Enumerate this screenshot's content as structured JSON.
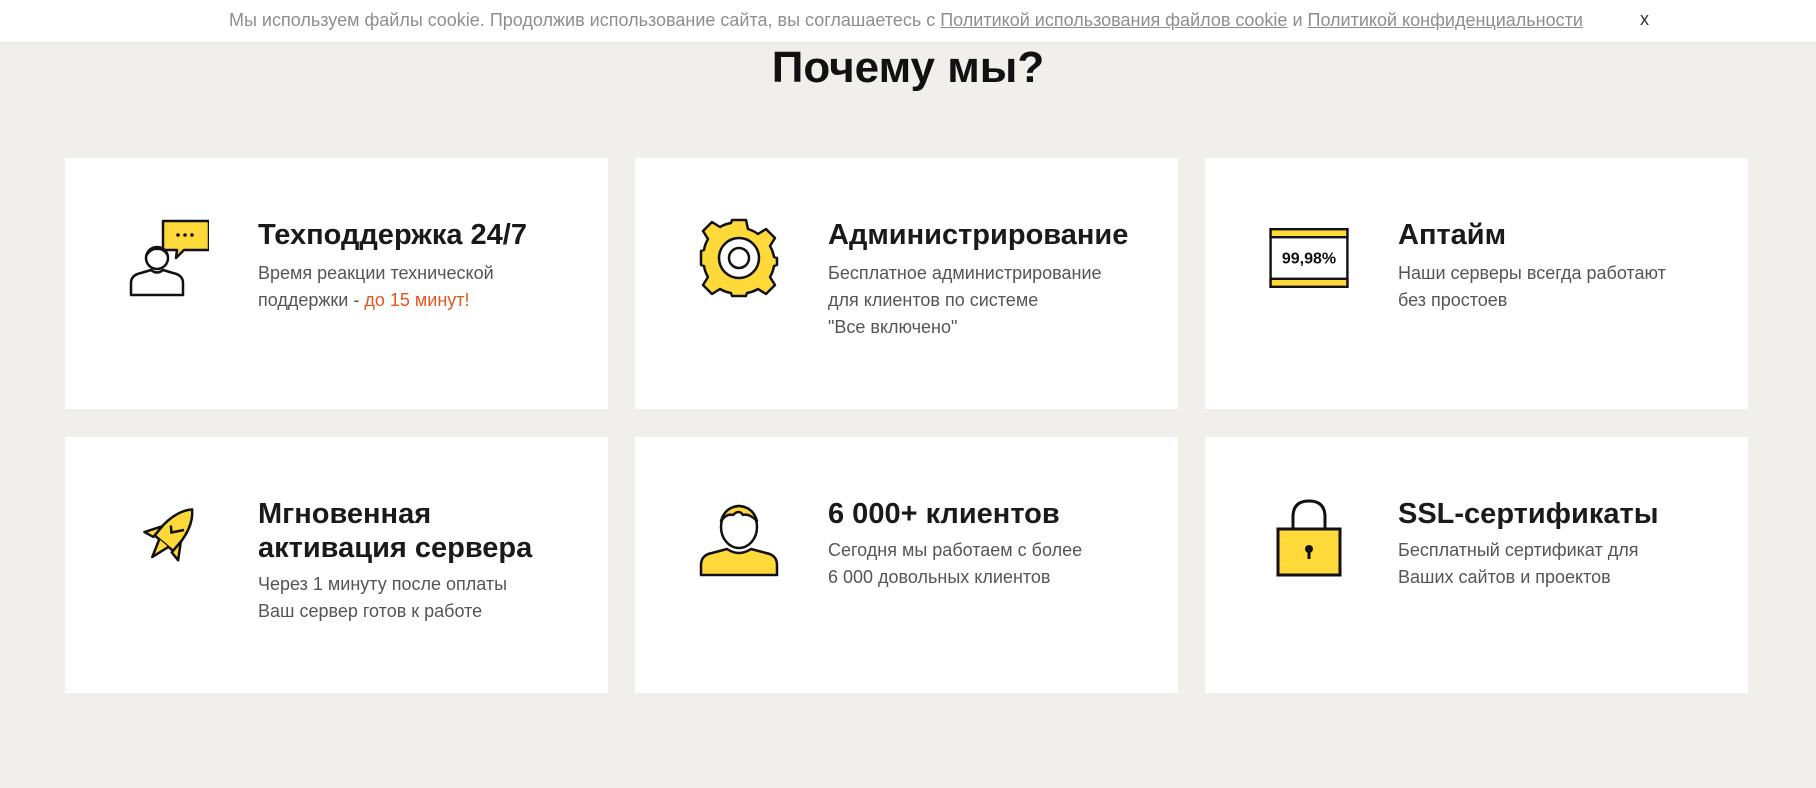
{
  "cookie": {
    "text_before": "Мы используем файлы cookie. Продолжив использование сайта, вы соглашаетесь с ",
    "link1": "Политикой использования файлов cookie",
    "text_and": " и ",
    "link2": "Политикой конфиденциальности",
    "close_label": "x"
  },
  "section": {
    "title": "Почему мы?"
  },
  "colors": {
    "accent_yellow": "#ffd83a",
    "accent_orange": "#e2571e",
    "background": "#f0efeb"
  },
  "features": [
    {
      "icon": "support-chat-icon",
      "title": "Техподдержка 24/7",
      "desc_line1": "Время реакции технической",
      "desc_line2": "поддержки - ",
      "desc_accent": "до 15 минут!"
    },
    {
      "icon": "gear-icon",
      "title": "Администрирование",
      "desc_line1": "Бесплатное администрирование",
      "desc_line2": "для клиентов по системе",
      "desc_line3": "\"Все включено\""
    },
    {
      "icon": "uptime-badge-icon",
      "icon_text": "99,98%",
      "title": "Аптайм",
      "desc_line1": "Наши серверы всегда работают",
      "desc_line2": "без простоев"
    },
    {
      "icon": "rocket-icon",
      "title_line1": "Мгновенная",
      "title_line2": "активация сервера",
      "desc_line1": "Через 1 минуту после оплаты",
      "desc_line2": "Ваш сервер готов к работе"
    },
    {
      "icon": "user-icon",
      "title": "6 000+ клиентов",
      "desc_line1": "Сегодня мы работаем с более",
      "desc_line2": "6 000 довольных клиентов"
    },
    {
      "icon": "lock-icon",
      "title": "SSL-сертификаты",
      "desc_line1": "Бесплатный сертификат для",
      "desc_line2": "Ваших сайтов и проектов"
    }
  ]
}
